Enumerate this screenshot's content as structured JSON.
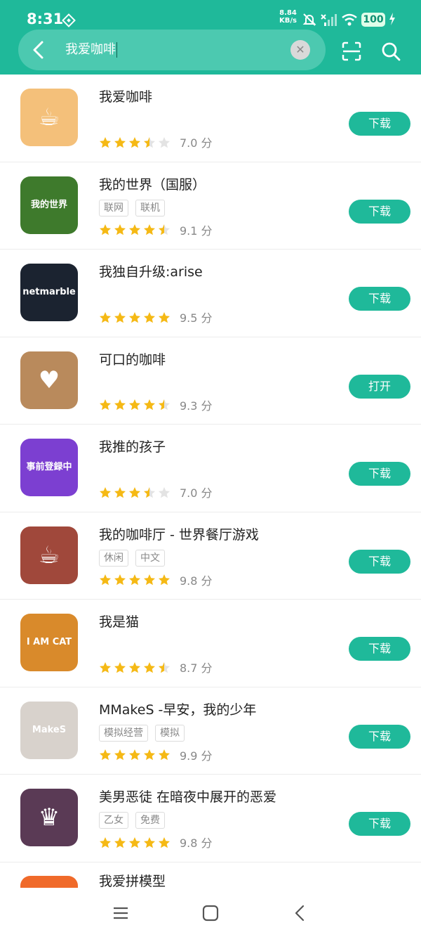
{
  "status_bar": {
    "time": "8:31",
    "net_speed_value": "8.84",
    "net_speed_unit": "KB/s",
    "battery": "100"
  },
  "search": {
    "query": "我爱咖啡",
    "icons": [
      "back-icon",
      "clear-icon",
      "scan-icon",
      "search-icon"
    ]
  },
  "colors": {
    "brand": "#1fb99a",
    "star_filled": "#f5b915",
    "star_empty": "#e3e3e3"
  },
  "results": [
    {
      "name": "我爱咖啡",
      "tags": [],
      "stars": 3.5,
      "score": "7.0 分",
      "action": "下载",
      "icon_color": "#f4c07a",
      "icon_text": "☕"
    },
    {
      "name": "我的世界（国服）",
      "tags": [
        "联网",
        "联机"
      ],
      "stars": 4.5,
      "score": "9.1 分",
      "action": "下载",
      "icon_color": "#3e7a2c",
      "icon_text": "我的世界"
    },
    {
      "name": "我独自升级:arise",
      "tags": [],
      "stars": 5,
      "score": "9.5 分",
      "action": "下载",
      "icon_color": "#1b2330",
      "icon_text": "netmarble"
    },
    {
      "name": "可口的咖啡",
      "tags": [],
      "stars": 4.5,
      "score": "9.3 分",
      "action": "打开",
      "icon_color": "#b98a5c",
      "icon_text": "♥"
    },
    {
      "name": "我推的孩子",
      "tags": [],
      "stars": 3.5,
      "score": "7.0 分",
      "action": "下载",
      "icon_color": "#7c3fd1",
      "icon_text": "事前登録中"
    },
    {
      "name": "我的咖啡厅 - 世界餐厅游戏",
      "tags": [
        "休闲",
        "中文"
      ],
      "stars": 5,
      "score": "9.8 分",
      "action": "下载",
      "icon_color": "#a0483b",
      "icon_text": "☕"
    },
    {
      "name": "我是猫",
      "tags": [],
      "stars": 4.5,
      "score": "8.7 分",
      "action": "下载",
      "icon_color": "#d98a2b",
      "icon_text": "I AM CAT"
    },
    {
      "name": "MMakeS -早安，我的少年",
      "tags": [
        "模拟经营",
        "模拟"
      ],
      "stars": 5,
      "score": "9.9 分",
      "action": "下载",
      "icon_color": "#d8d2cc",
      "icon_text": "MakeS"
    },
    {
      "name": "美男恶徒 在暗夜中展开的恶爱",
      "tags": [
        "乙女",
        "免费"
      ],
      "stars": 5,
      "score": "9.8 分",
      "action": "下载",
      "icon_color": "#5a3a55",
      "icon_text": "♛"
    }
  ],
  "partial_item": {
    "name": "我爱拼模型",
    "icon_color": "#f06a2a"
  },
  "nav_bar": {
    "icons": [
      "menu-icon",
      "home-icon",
      "back-nav-icon"
    ]
  }
}
